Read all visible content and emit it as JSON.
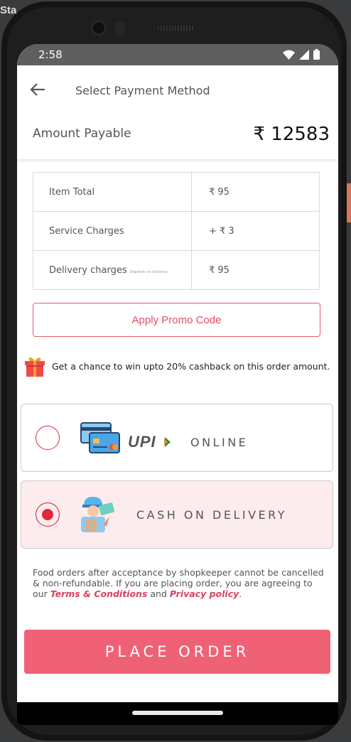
{
  "background": {
    "partial_text": "Sta"
  },
  "status_bar": {
    "time": "2:58"
  },
  "header": {
    "title": "Select Payment Method"
  },
  "amount": {
    "label": "Amount Payable",
    "value": "₹ 12583"
  },
  "charges": [
    {
      "label": "Item Total",
      "note": "",
      "value": "₹ 95"
    },
    {
      "label": "Service Charges",
      "note": "",
      "value": "+ ₹ 3"
    },
    {
      "label": "Delivery charges",
      "note": "Depends on distance",
      "value": "₹ 95"
    }
  ],
  "promo": {
    "label": "Apply Promo Code"
  },
  "cashback": {
    "text": "Get a chance to win upto 20% cashback on this order amount."
  },
  "payment_options": [
    {
      "label": "ONLINE",
      "logo_text": "UPI",
      "selected": false
    },
    {
      "label": "CASH ON DELIVERY",
      "selected": true
    }
  ],
  "terms": {
    "text_before": "Food orders after acceptance by shopkeeper cannot be cancelled & non-refundable. If you are placing order, you are agreeing to our ",
    "terms_link": "Terms & Conditions",
    "and": " and ",
    "privacy_link": "Privacy policy",
    "end": "."
  },
  "place_order": {
    "label": "PLACE ORDER"
  },
  "colors": {
    "accent": "#ef6275",
    "radio": "#e0283a",
    "selected_bg": "#fdecee",
    "link": "#d9415d"
  }
}
